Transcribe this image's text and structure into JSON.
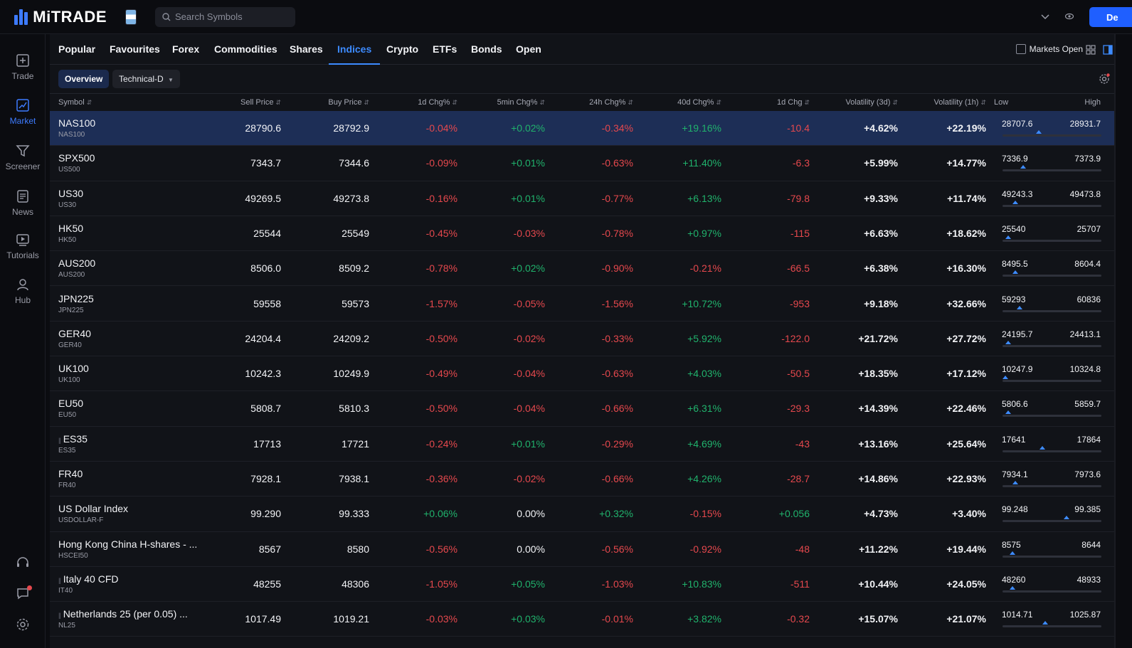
{
  "header": {
    "logo_text": "MiTRADE",
    "search_placeholder": "Search Symbols",
    "deposit_label": "De"
  },
  "sidenav": [
    {
      "label": "Trade",
      "icon": "trade-icon"
    },
    {
      "label": "Market",
      "icon": "market-icon",
      "active": true
    },
    {
      "label": "Screener",
      "icon": "screener-icon"
    },
    {
      "label": "News",
      "icon": "news-icon"
    },
    {
      "label": "Tutorials",
      "icon": "tutorials-icon"
    },
    {
      "label": "Hub",
      "icon": "hub-icon"
    }
  ],
  "tabs": [
    {
      "label": "Popular"
    },
    {
      "label": "Favourites"
    },
    {
      "label": "Forex"
    },
    {
      "label": "Commodities"
    },
    {
      "label": "Shares"
    },
    {
      "label": "Indices",
      "active": true
    },
    {
      "label": "Crypto"
    },
    {
      "label": "ETFs"
    },
    {
      "label": "Bonds"
    },
    {
      "label": "Open"
    }
  ],
  "markets_open_label": "Markets Open",
  "subtabs": {
    "overview": "Overview",
    "technical": "Technical-D"
  },
  "columns": {
    "symbol": "Symbol",
    "sell": "Sell Price",
    "buy": "Buy Price",
    "chg_1d_pct": "1d Chg%",
    "chg_5min_pct": "5min Chg%",
    "chg_24h_pct": "24h Chg%",
    "chg_40d_pct": "40d Chg%",
    "chg_1d": "1d Chg",
    "vol_3d": "Volatility (3d)",
    "vol_1h": "Volatility (1h)",
    "low": "Low",
    "high": "High"
  },
  "rows": [
    {
      "name": "NAS100",
      "code": "NAS100",
      "sell": "28790.6",
      "buy": "28792.9",
      "c1d": "-0.04%",
      "c5m": "+0.02%",
      "c24h": "-0.34%",
      "c40d": "+19.16%",
      "d1": "-10.4",
      "v3d": "+4.62%",
      "v1h": "+22.19%",
      "low": "28707.6",
      "high": "28931.7",
      "pos": 0.37,
      "selected": true
    },
    {
      "name": "SPX500",
      "code": "US500",
      "sell": "7343.7",
      "buy": "7344.6",
      "c1d": "-0.09%",
      "c5m": "+0.01%",
      "c24h": "-0.63%",
      "c40d": "+11.40%",
      "d1": "-6.3",
      "v3d": "+5.99%",
      "v1h": "+14.77%",
      "low": "7336.9",
      "high": "7373.9",
      "pos": 0.21
    },
    {
      "name": "US30",
      "code": "US30",
      "sell": "49269.5",
      "buy": "49273.8",
      "c1d": "-0.16%",
      "c5m": "+0.01%",
      "c24h": "-0.77%",
      "c40d": "+6.13%",
      "d1": "-79.8",
      "v3d": "+9.33%",
      "v1h": "+11.74%",
      "low": "49243.3",
      "high": "49473.8",
      "pos": 0.13
    },
    {
      "name": "HK50",
      "code": "HK50",
      "sell": "25544",
      "buy": "25549",
      "c1d": "-0.45%",
      "c5m": "-0.03%",
      "c24h": "-0.78%",
      "c40d": "+0.97%",
      "d1": "-115",
      "v3d": "+6.63%",
      "v1h": "+18.62%",
      "low": "25540",
      "high": "25707",
      "pos": 0.06
    },
    {
      "name": "AUS200",
      "code": "AUS200",
      "sell": "8506.0",
      "buy": "8509.2",
      "c1d": "-0.78%",
      "c5m": "+0.02%",
      "c24h": "-0.90%",
      "c40d": "-0.21%",
      "d1": "-66.5",
      "v3d": "+6.38%",
      "v1h": "+16.30%",
      "low": "8495.5",
      "high": "8604.4",
      "pos": 0.13
    },
    {
      "name": "JPN225",
      "code": "JPN225",
      "sell": "59558",
      "buy": "59573",
      "c1d": "-1.57%",
      "c5m": "-0.05%",
      "c24h": "-1.56%",
      "c40d": "+10.72%",
      "d1": "-953",
      "v3d": "+9.18%",
      "v1h": "+32.66%",
      "low": "59293",
      "high": "60836",
      "pos": 0.17
    },
    {
      "name": "GER40",
      "code": "GER40",
      "sell": "24204.4",
      "buy": "24209.2",
      "c1d": "-0.50%",
      "c5m": "-0.02%",
      "c24h": "-0.33%",
      "c40d": "+5.92%",
      "d1": "-122.0",
      "v3d": "+21.72%",
      "v1h": "+27.72%",
      "low": "24195.7",
      "high": "24413.1",
      "pos": 0.06
    },
    {
      "name": "UK100",
      "code": "UK100",
      "sell": "10242.3",
      "buy": "10249.9",
      "c1d": "-0.49%",
      "c5m": "-0.04%",
      "c24h": "-0.63%",
      "c40d": "+4.03%",
      "d1": "-50.5",
      "v3d": "+18.35%",
      "v1h": "+17.12%",
      "low": "10247.9",
      "high": "10324.8",
      "pos": 0.03
    },
    {
      "name": "EU50",
      "code": "EU50",
      "sell": "5808.7",
      "buy": "5810.3",
      "c1d": "-0.50%",
      "c5m": "-0.04%",
      "c24h": "-0.66%",
      "c40d": "+6.31%",
      "d1": "-29.3",
      "v3d": "+14.39%",
      "v1h": "+22.46%",
      "low": "5806.6",
      "high": "5859.7",
      "pos": 0.06
    },
    {
      "name": "ES35",
      "code": "ES35",
      "sell": "17713",
      "buy": "17721",
      "c1d": "-0.24%",
      "c5m": "+0.01%",
      "c24h": "-0.29%",
      "c40d": "+4.69%",
      "d1": "-43",
      "v3d": "+13.16%",
      "v1h": "+25.64%",
      "low": "17641",
      "high": "17864",
      "pos": 0.4,
      "grip": true
    },
    {
      "name": "FR40",
      "code": "FR40",
      "sell": "7928.1",
      "buy": "7938.1",
      "c1d": "-0.36%",
      "c5m": "-0.02%",
      "c24h": "-0.66%",
      "c40d": "+4.26%",
      "d1": "-28.7",
      "v3d": "+14.86%",
      "v1h": "+22.93%",
      "low": "7934.1",
      "high": "7973.6",
      "pos": 0.13
    },
    {
      "name": "US Dollar Index",
      "code": "USDOLLAR-F",
      "sell": "99.290",
      "buy": "99.333",
      "c1d": "+0.06%",
      "c5m": "0.00%",
      "c24h": "+0.32%",
      "c40d": "-0.15%",
      "d1": "+0.056",
      "v3d": "+4.73%",
      "v1h": "+3.40%",
      "low": "99.248",
      "high": "99.385",
      "pos": 0.65
    },
    {
      "name": "Hong Kong China H-shares - ...",
      "code": "HSCEI50",
      "sell": "8567",
      "buy": "8580",
      "c1d": "-0.56%",
      "c5m": "0.00%",
      "c24h": "-0.56%",
      "c40d": "-0.92%",
      "d1": "-48",
      "v3d": "+11.22%",
      "v1h": "+19.44%",
      "low": "8575",
      "high": "8644",
      "pos": 0.1
    },
    {
      "name": "Italy 40 CFD",
      "code": "IT40",
      "sell": "48255",
      "buy": "48306",
      "c1d": "-1.05%",
      "c5m": "+0.05%",
      "c24h": "-1.03%",
      "c40d": "+10.83%",
      "d1": "-511",
      "v3d": "+10.44%",
      "v1h": "+24.05%",
      "low": "48260",
      "high": "48933",
      "pos": 0.1,
      "grip": true
    },
    {
      "name": "Netherlands 25 (per 0.05) ...",
      "code": "NL25",
      "sell": "1017.49",
      "buy": "1019.21",
      "c1d": "-0.03%",
      "c5m": "+0.03%",
      "c24h": "-0.01%",
      "c40d": "+3.82%",
      "d1": "-0.32",
      "v3d": "+15.07%",
      "v1h": "+21.07%",
      "low": "1014.71",
      "high": "1025.87",
      "pos": 0.43,
      "grip": true
    }
  ],
  "colors": {
    "accent": "#3d8bff",
    "positive": "#20b26c",
    "negative": "#e5484d",
    "selected_row": "#1d2e56"
  }
}
